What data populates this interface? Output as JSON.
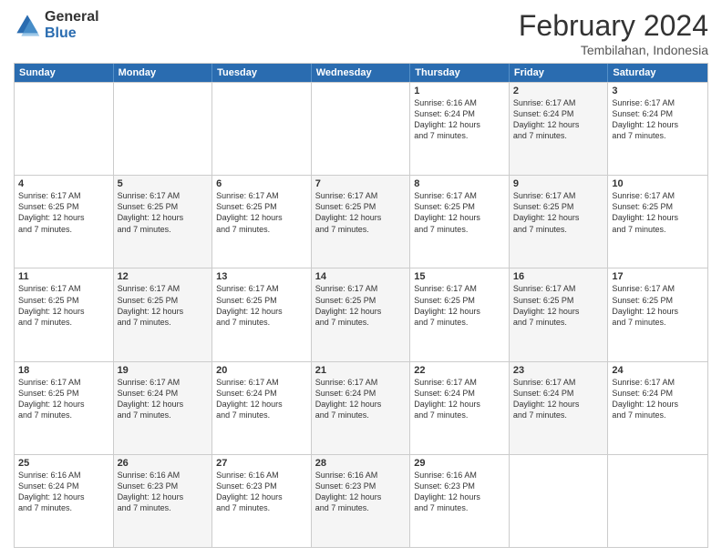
{
  "logo": {
    "general": "General",
    "blue": "Blue"
  },
  "title": {
    "month": "February 2024",
    "location": "Tembilahan, Indonesia"
  },
  "header_days": [
    "Sunday",
    "Monday",
    "Tuesday",
    "Wednesday",
    "Thursday",
    "Friday",
    "Saturday"
  ],
  "weeks": [
    [
      {
        "day": "",
        "info": "",
        "shaded": false
      },
      {
        "day": "",
        "info": "",
        "shaded": false
      },
      {
        "day": "",
        "info": "",
        "shaded": false
      },
      {
        "day": "",
        "info": "",
        "shaded": false
      },
      {
        "day": "1",
        "info": "Sunrise: 6:16 AM\nSunset: 6:24 PM\nDaylight: 12 hours\nand 7 minutes.",
        "shaded": false
      },
      {
        "day": "2",
        "info": "Sunrise: 6:17 AM\nSunset: 6:24 PM\nDaylight: 12 hours\nand 7 minutes.",
        "shaded": true
      },
      {
        "day": "3",
        "info": "Sunrise: 6:17 AM\nSunset: 6:24 PM\nDaylight: 12 hours\nand 7 minutes.",
        "shaded": false
      }
    ],
    [
      {
        "day": "4",
        "info": "Sunrise: 6:17 AM\nSunset: 6:25 PM\nDaylight: 12 hours\nand 7 minutes.",
        "shaded": false
      },
      {
        "day": "5",
        "info": "Sunrise: 6:17 AM\nSunset: 6:25 PM\nDaylight: 12 hours\nand 7 minutes.",
        "shaded": true
      },
      {
        "day": "6",
        "info": "Sunrise: 6:17 AM\nSunset: 6:25 PM\nDaylight: 12 hours\nand 7 minutes.",
        "shaded": false
      },
      {
        "day": "7",
        "info": "Sunrise: 6:17 AM\nSunset: 6:25 PM\nDaylight: 12 hours\nand 7 minutes.",
        "shaded": true
      },
      {
        "day": "8",
        "info": "Sunrise: 6:17 AM\nSunset: 6:25 PM\nDaylight: 12 hours\nand 7 minutes.",
        "shaded": false
      },
      {
        "day": "9",
        "info": "Sunrise: 6:17 AM\nSunset: 6:25 PM\nDaylight: 12 hours\nand 7 minutes.",
        "shaded": true
      },
      {
        "day": "10",
        "info": "Sunrise: 6:17 AM\nSunset: 6:25 PM\nDaylight: 12 hours\nand 7 minutes.",
        "shaded": false
      }
    ],
    [
      {
        "day": "11",
        "info": "Sunrise: 6:17 AM\nSunset: 6:25 PM\nDaylight: 12 hours\nand 7 minutes.",
        "shaded": false
      },
      {
        "day": "12",
        "info": "Sunrise: 6:17 AM\nSunset: 6:25 PM\nDaylight: 12 hours\nand 7 minutes.",
        "shaded": true
      },
      {
        "day": "13",
        "info": "Sunrise: 6:17 AM\nSunset: 6:25 PM\nDaylight: 12 hours\nand 7 minutes.",
        "shaded": false
      },
      {
        "day": "14",
        "info": "Sunrise: 6:17 AM\nSunset: 6:25 PM\nDaylight: 12 hours\nand 7 minutes.",
        "shaded": true
      },
      {
        "day": "15",
        "info": "Sunrise: 6:17 AM\nSunset: 6:25 PM\nDaylight: 12 hours\nand 7 minutes.",
        "shaded": false
      },
      {
        "day": "16",
        "info": "Sunrise: 6:17 AM\nSunset: 6:25 PM\nDaylight: 12 hours\nand 7 minutes.",
        "shaded": true
      },
      {
        "day": "17",
        "info": "Sunrise: 6:17 AM\nSunset: 6:25 PM\nDaylight: 12 hours\nand 7 minutes.",
        "shaded": false
      }
    ],
    [
      {
        "day": "18",
        "info": "Sunrise: 6:17 AM\nSunset: 6:25 PM\nDaylight: 12 hours\nand 7 minutes.",
        "shaded": false
      },
      {
        "day": "19",
        "info": "Sunrise: 6:17 AM\nSunset: 6:24 PM\nDaylight: 12 hours\nand 7 minutes.",
        "shaded": true
      },
      {
        "day": "20",
        "info": "Sunrise: 6:17 AM\nSunset: 6:24 PM\nDaylight: 12 hours\nand 7 minutes.",
        "shaded": false
      },
      {
        "day": "21",
        "info": "Sunrise: 6:17 AM\nSunset: 6:24 PM\nDaylight: 12 hours\nand 7 minutes.",
        "shaded": true
      },
      {
        "day": "22",
        "info": "Sunrise: 6:17 AM\nSunset: 6:24 PM\nDaylight: 12 hours\nand 7 minutes.",
        "shaded": false
      },
      {
        "day": "23",
        "info": "Sunrise: 6:17 AM\nSunset: 6:24 PM\nDaylight: 12 hours\nand 7 minutes.",
        "shaded": true
      },
      {
        "day": "24",
        "info": "Sunrise: 6:17 AM\nSunset: 6:24 PM\nDaylight: 12 hours\nand 7 minutes.",
        "shaded": false
      }
    ],
    [
      {
        "day": "25",
        "info": "Sunrise: 6:16 AM\nSunset: 6:24 PM\nDaylight: 12 hours\nand 7 minutes.",
        "shaded": false
      },
      {
        "day": "26",
        "info": "Sunrise: 6:16 AM\nSunset: 6:23 PM\nDaylight: 12 hours\nand 7 minutes.",
        "shaded": true
      },
      {
        "day": "27",
        "info": "Sunrise: 6:16 AM\nSunset: 6:23 PM\nDaylight: 12 hours\nand 7 minutes.",
        "shaded": false
      },
      {
        "day": "28",
        "info": "Sunrise: 6:16 AM\nSunset: 6:23 PM\nDaylight: 12 hours\nand 7 minutes.",
        "shaded": true
      },
      {
        "day": "29",
        "info": "Sunrise: 6:16 AM\nSunset: 6:23 PM\nDaylight: 12 hours\nand 7 minutes.",
        "shaded": false
      },
      {
        "day": "",
        "info": "",
        "shaded": false
      },
      {
        "day": "",
        "info": "",
        "shaded": false
      }
    ]
  ]
}
